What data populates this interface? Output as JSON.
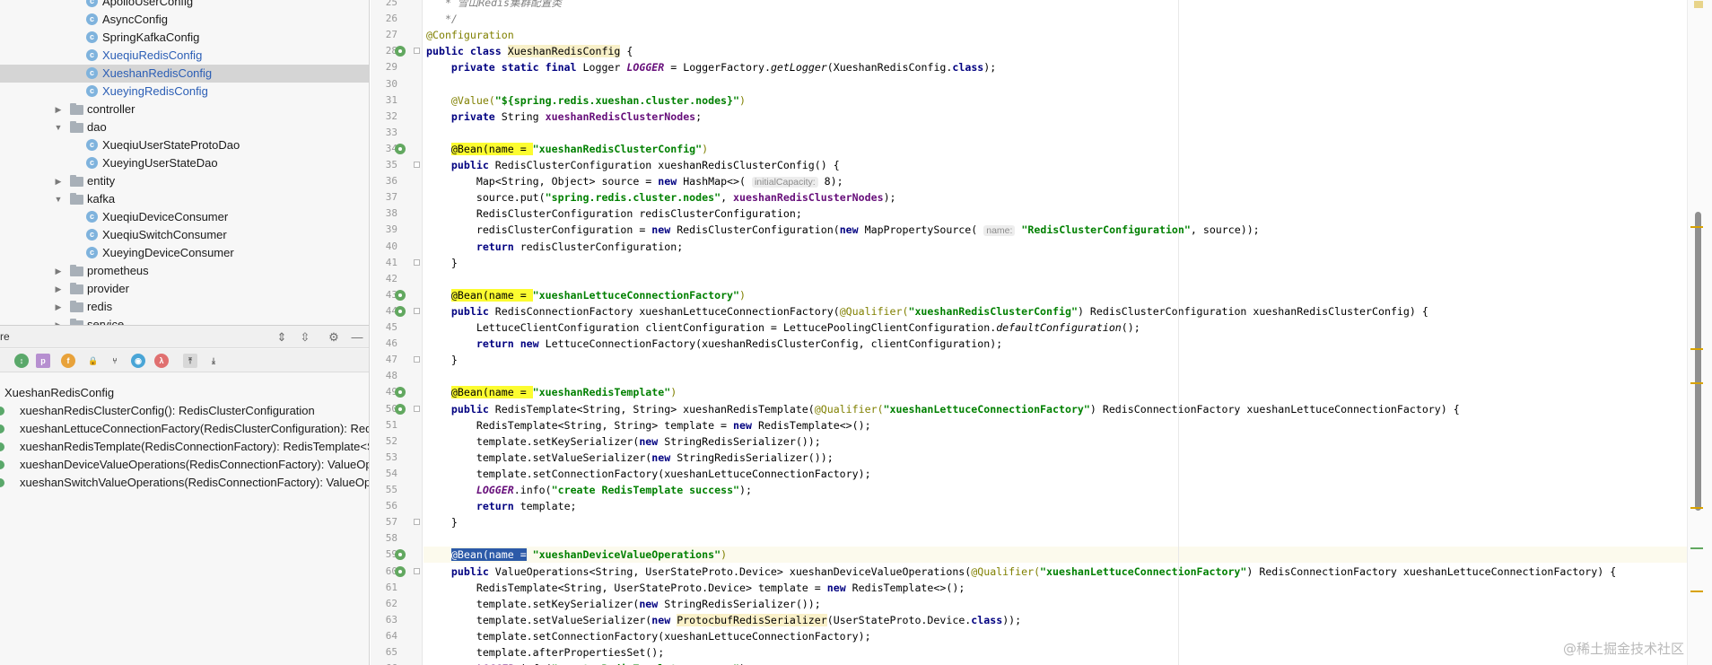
{
  "project_tree": [
    {
      "label": "ApolloUserConfig",
      "kind": "class",
      "indent": 2,
      "link": false
    },
    {
      "label": "AsyncConfig",
      "kind": "class",
      "indent": 2,
      "link": false
    },
    {
      "label": "SpringKafkaConfig",
      "kind": "class",
      "indent": 2,
      "link": false
    },
    {
      "label": "XueqiuRedisConfig",
      "kind": "class",
      "indent": 2,
      "link": true
    },
    {
      "label": "XueshanRedisConfig",
      "kind": "class",
      "indent": 2,
      "link": true,
      "selected": true
    },
    {
      "label": "XueyingRedisConfig",
      "kind": "class",
      "indent": 2,
      "link": true
    },
    {
      "label": "controller",
      "kind": "folder",
      "indent": 1,
      "expanded": false
    },
    {
      "label": "dao",
      "kind": "folder",
      "indent": 1,
      "expanded": true
    },
    {
      "label": "XueqiuUserStateProtoDao",
      "kind": "class",
      "indent": 2,
      "link": false
    },
    {
      "label": "XueyingUserStateDao",
      "kind": "class",
      "indent": 2,
      "link": false
    },
    {
      "label": "entity",
      "kind": "folder",
      "indent": 1,
      "expanded": false
    },
    {
      "label": "kafka",
      "kind": "folder",
      "indent": 1,
      "expanded": true
    },
    {
      "label": "XueqiuDeviceConsumer",
      "kind": "class",
      "indent": 2,
      "link": false
    },
    {
      "label": "XueqiuSwitchConsumer",
      "kind": "class",
      "indent": 2,
      "link": false
    },
    {
      "label": "XueyingDeviceConsumer",
      "kind": "class",
      "indent": 2,
      "link": false
    },
    {
      "label": "prometheus",
      "kind": "folder",
      "indent": 1,
      "expanded": false
    },
    {
      "label": "provider",
      "kind": "folder",
      "indent": 1,
      "expanded": false
    },
    {
      "label": "redis",
      "kind": "folder",
      "indent": 1,
      "expanded": false
    },
    {
      "label": "service",
      "kind": "folder",
      "indent": 1,
      "expanded": false
    }
  ],
  "structure": {
    "title": "re",
    "root": "XueshanRedisConfig",
    "members": [
      "xueshanRedisClusterConfig(): RedisClusterConfiguration",
      "xueshanLettuceConnectionFactory(RedisClusterConfiguration): RedisConnectionFactory",
      "xueshanRedisTemplate(RedisConnectionFactory): RedisTemplate<String, String>",
      "xueshanDeviceValueOperations(RedisConnectionFactory): ValueOperations<String, UserStateProto.Device>",
      "xueshanSwitchValueOperations(RedisConnectionFactory): ValueOperations<String, UserStateProto.Switch>"
    ],
    "toolbar_icons": [
      "sort-icon",
      "property-icon",
      "field-icon",
      "lock-icon",
      "inherited-icon",
      "anonymous-icon",
      "lambda-icon",
      "autoscroll-to-source-icon",
      "autoscroll-from-source-icon"
    ]
  },
  "editor": {
    "first_line": 25,
    "gutter_beans": [
      28,
      34,
      43,
      44,
      49,
      50,
      59,
      60
    ],
    "current_line": 59,
    "lines": [
      {
        "n": 25,
        "tokens": [
          {
            "t": "   * 雪山Redis集群配置类",
            "c": "cmt"
          }
        ]
      },
      {
        "n": 26,
        "tokens": [
          {
            "t": "   */",
            "c": "cmt"
          }
        ]
      },
      {
        "n": 27,
        "tokens": [
          {
            "t": "@Configuration",
            "c": "ann"
          }
        ]
      },
      {
        "n": 28,
        "tokens": [
          {
            "t": "public class ",
            "c": "kw"
          },
          {
            "t": "XueshanRedisConfig",
            "c": "hlclass"
          },
          {
            "t": " {",
            "c": ""
          }
        ]
      },
      {
        "n": 29,
        "tokens": [
          {
            "t": "    private static final ",
            "c": "kw"
          },
          {
            "t": "Logger ",
            "c": ""
          },
          {
            "t": "LOGGER",
            "c": "sfld"
          },
          {
            "t": " = LoggerFactory.",
            "c": ""
          },
          {
            "t": "getLogger",
            "c": "it"
          },
          {
            "t": "(XueshanRedisConfig.",
            "c": ""
          },
          {
            "t": "class",
            "c": "kw"
          },
          {
            "t": ");",
            "c": ""
          }
        ]
      },
      {
        "n": 30,
        "tokens": []
      },
      {
        "n": 31,
        "tokens": [
          {
            "t": "    @Value(",
            "c": "ann"
          },
          {
            "t": "\"${spring.redis.xueshan.cluster.nodes}\"",
            "c": "str"
          },
          {
            "t": ")",
            "c": "ann"
          }
        ]
      },
      {
        "n": 32,
        "tokens": [
          {
            "t": "    private ",
            "c": "kw"
          },
          {
            "t": "String ",
            "c": ""
          },
          {
            "t": "xueshanRedisClusterNodes",
            "c": "fld"
          },
          {
            "t": ";",
            "c": ""
          }
        ]
      },
      {
        "n": 33,
        "tokens": []
      },
      {
        "n": 34,
        "tokens": [
          {
            "t": "    ",
            "c": ""
          },
          {
            "t": "@Bean(name = ",
            "c": "hlbean"
          },
          {
            "t": "\"xueshanRedisClusterConfig\"",
            "c": "str"
          },
          {
            "t": ")",
            "c": "ann"
          }
        ]
      },
      {
        "n": 35,
        "tokens": [
          {
            "t": "    public ",
            "c": "kw"
          },
          {
            "t": "RedisClusterConfiguration xueshanRedisClusterConfig() {",
            "c": ""
          }
        ]
      },
      {
        "n": 36,
        "tokens": [
          {
            "t": "        Map<String, Object> source = ",
            "c": ""
          },
          {
            "t": "new ",
            "c": "kw"
          },
          {
            "t": "HashMap<>( ",
            "c": ""
          },
          {
            "t": "initialCapacity:",
            "c": "hint"
          },
          {
            "t": " 8);",
            "c": ""
          }
        ]
      },
      {
        "n": 37,
        "tokens": [
          {
            "t": "        source.put(",
            "c": ""
          },
          {
            "t": "\"spring.redis.cluster.nodes\"",
            "c": "str"
          },
          {
            "t": ", ",
            "c": ""
          },
          {
            "t": "xueshanRedisClusterNodes",
            "c": "fld"
          },
          {
            "t": ");",
            "c": ""
          }
        ]
      },
      {
        "n": 38,
        "tokens": [
          {
            "t": "        RedisClusterConfiguration redisClusterConfiguration;",
            "c": ""
          }
        ]
      },
      {
        "n": 39,
        "tokens": [
          {
            "t": "        redisClusterConfiguration = ",
            "c": ""
          },
          {
            "t": "new ",
            "c": "kw"
          },
          {
            "t": "RedisClusterConfiguration(",
            "c": ""
          },
          {
            "t": "new ",
            "c": "kw"
          },
          {
            "t": "MapPropertySource( ",
            "c": ""
          },
          {
            "t": "name:",
            "c": "hint"
          },
          {
            "t": " ",
            "c": ""
          },
          {
            "t": "\"RedisClusterConfiguration\"",
            "c": "str"
          },
          {
            "t": ", source));",
            "c": ""
          }
        ]
      },
      {
        "n": 40,
        "tokens": [
          {
            "t": "        return ",
            "c": "kw"
          },
          {
            "t": "redisClusterConfiguration;",
            "c": ""
          }
        ]
      },
      {
        "n": 41,
        "tokens": [
          {
            "t": "    }",
            "c": ""
          }
        ]
      },
      {
        "n": 42,
        "tokens": []
      },
      {
        "n": 43,
        "tokens": [
          {
            "t": "    ",
            "c": ""
          },
          {
            "t": "@Bean(name = ",
            "c": "hlbean"
          },
          {
            "t": "\"xueshanLettuceConnectionFactory\"",
            "c": "str"
          },
          {
            "t": ")",
            "c": "ann"
          }
        ]
      },
      {
        "n": 44,
        "tokens": [
          {
            "t": "    public ",
            "c": "kw"
          },
          {
            "t": "RedisConnectionFactory xueshanLettuceConnectionFactory(",
            "c": ""
          },
          {
            "t": "@Qualifier(",
            "c": "ann"
          },
          {
            "t": "\"xueshanRedisClusterConfig\"",
            "c": "str"
          },
          {
            "t": ") RedisClusterConfiguration xueshanRedisClusterConfig) {",
            "c": ""
          }
        ]
      },
      {
        "n": 45,
        "tokens": [
          {
            "t": "        LettuceClientConfiguration clientConfiguration = LettucePoolingClientConfiguration.",
            "c": ""
          },
          {
            "t": "defaultConfiguration",
            "c": "it"
          },
          {
            "t": "();",
            "c": ""
          }
        ]
      },
      {
        "n": 46,
        "tokens": [
          {
            "t": "        return new ",
            "c": "kw"
          },
          {
            "t": "LettuceConnectionFactory(xueshanRedisClusterConfig, clientConfiguration);",
            "c": ""
          }
        ]
      },
      {
        "n": 47,
        "tokens": [
          {
            "t": "    }",
            "c": ""
          }
        ]
      },
      {
        "n": 48,
        "tokens": []
      },
      {
        "n": 49,
        "tokens": [
          {
            "t": "    ",
            "c": ""
          },
          {
            "t": "@Bean(name = ",
            "c": "hlbean"
          },
          {
            "t": "\"xueshanRedisTemplate\"",
            "c": "str"
          },
          {
            "t": ")",
            "c": "ann"
          }
        ]
      },
      {
        "n": 50,
        "tokens": [
          {
            "t": "    public ",
            "c": "kw"
          },
          {
            "t": "RedisTemplate<String, String> xueshanRedisTemplate(",
            "c": ""
          },
          {
            "t": "@Qualifier(",
            "c": "ann"
          },
          {
            "t": "\"xueshanLettuceConnectionFactory\"",
            "c": "str"
          },
          {
            "t": ") RedisConnectionFactory xueshanLettuceConnectionFactory) {",
            "c": ""
          }
        ]
      },
      {
        "n": 51,
        "tokens": [
          {
            "t": "        RedisTemplate<String, String> template = ",
            "c": ""
          },
          {
            "t": "new ",
            "c": "kw"
          },
          {
            "t": "RedisTemplate<>();",
            "c": ""
          }
        ]
      },
      {
        "n": 52,
        "tokens": [
          {
            "t": "        template.setKeySerializer(",
            "c": ""
          },
          {
            "t": "new ",
            "c": "kw"
          },
          {
            "t": "StringRedisSerializer());",
            "c": ""
          }
        ]
      },
      {
        "n": 53,
        "tokens": [
          {
            "t": "        template.setValueSerializer(",
            "c": ""
          },
          {
            "t": "new ",
            "c": "kw"
          },
          {
            "t": "StringRedisSerializer());",
            "c": ""
          }
        ]
      },
      {
        "n": 54,
        "tokens": [
          {
            "t": "        template.setConnectionFactory(xueshanLettuceConnectionFactory);",
            "c": ""
          }
        ]
      },
      {
        "n": 55,
        "tokens": [
          {
            "t": "        ",
            "c": ""
          },
          {
            "t": "LOGGER",
            "c": "sfld"
          },
          {
            "t": ".info(",
            "c": ""
          },
          {
            "t": "\"create RedisTemplate success\"",
            "c": "str"
          },
          {
            "t": ");",
            "c": ""
          }
        ]
      },
      {
        "n": 56,
        "tokens": [
          {
            "t": "        return ",
            "c": "kw"
          },
          {
            "t": "template;",
            "c": ""
          }
        ]
      },
      {
        "n": 57,
        "tokens": [
          {
            "t": "    }",
            "c": ""
          }
        ]
      },
      {
        "n": 58,
        "tokens": []
      },
      {
        "n": 59,
        "tokens": [
          {
            "t": "    ",
            "c": ""
          },
          {
            "t": "@Bean(name =",
            "c": "hlsel"
          },
          {
            "t": " ",
            "c": ""
          },
          {
            "t": "\"xueshanDeviceValueOperations\"",
            "c": "str"
          },
          {
            "t": ")",
            "c": "ann"
          }
        ]
      },
      {
        "n": 60,
        "tokens": [
          {
            "t": "    public ",
            "c": "kw"
          },
          {
            "t": "ValueOperations<String, UserStateProto.Device> xueshanDeviceValueOperations(",
            "c": ""
          },
          {
            "t": "@Qualifier(",
            "c": "ann"
          },
          {
            "t": "\"xueshanLettuceConnectionFactory\"",
            "c": "str"
          },
          {
            "t": ") RedisConnectionFactory xueshanLettuceConnectionFactory) {",
            "c": ""
          }
        ]
      },
      {
        "n": 61,
        "tokens": [
          {
            "t": "        RedisTemplate<String, UserStateProto.Device> template = ",
            "c": ""
          },
          {
            "t": "new ",
            "c": "kw"
          },
          {
            "t": "RedisTemplate<>();",
            "c": ""
          }
        ]
      },
      {
        "n": 62,
        "tokens": [
          {
            "t": "        template.setKeySerializer(",
            "c": ""
          },
          {
            "t": "new ",
            "c": "kw"
          },
          {
            "t": "StringRedisSerializer());",
            "c": ""
          }
        ]
      },
      {
        "n": 63,
        "tokens": [
          {
            "t": "        template.setValueSerializer(",
            "c": ""
          },
          {
            "t": "new ",
            "c": "kw"
          },
          {
            "t": "ProtocbufRedisSerializer",
            "c": "hlproto"
          },
          {
            "t": "(UserStateProto.Device.",
            "c": ""
          },
          {
            "t": "class",
            "c": "kw"
          },
          {
            "t": "));",
            "c": ""
          }
        ]
      },
      {
        "n": 64,
        "tokens": [
          {
            "t": "        template.setConnectionFactory(xueshanLettuceConnectionFactory);",
            "c": ""
          }
        ]
      },
      {
        "n": 65,
        "tokens": [
          {
            "t": "        template.afterPropertiesSet();",
            "c": ""
          }
        ]
      },
      {
        "n": 66,
        "tokens": [
          {
            "t": "        ",
            "c": ""
          },
          {
            "t": "LOGGER",
            "c": "sfld"
          },
          {
            "t": ".info(",
            "c": ""
          },
          {
            "t": "\"create RedisTemplate success\"",
            "c": "str"
          },
          {
            "t": ");",
            "c": ""
          }
        ]
      }
    ]
  },
  "scroll_marks": [
    {
      "color": "#d8a200"
    },
    {
      "color": "#d8a200"
    },
    {
      "color": "#d8a200"
    },
    {
      "color": "#d8a200"
    },
    {
      "color": "#62a860"
    },
    {
      "color": "#d8a200"
    }
  ],
  "watermark": "@稀土掘金技术社区"
}
